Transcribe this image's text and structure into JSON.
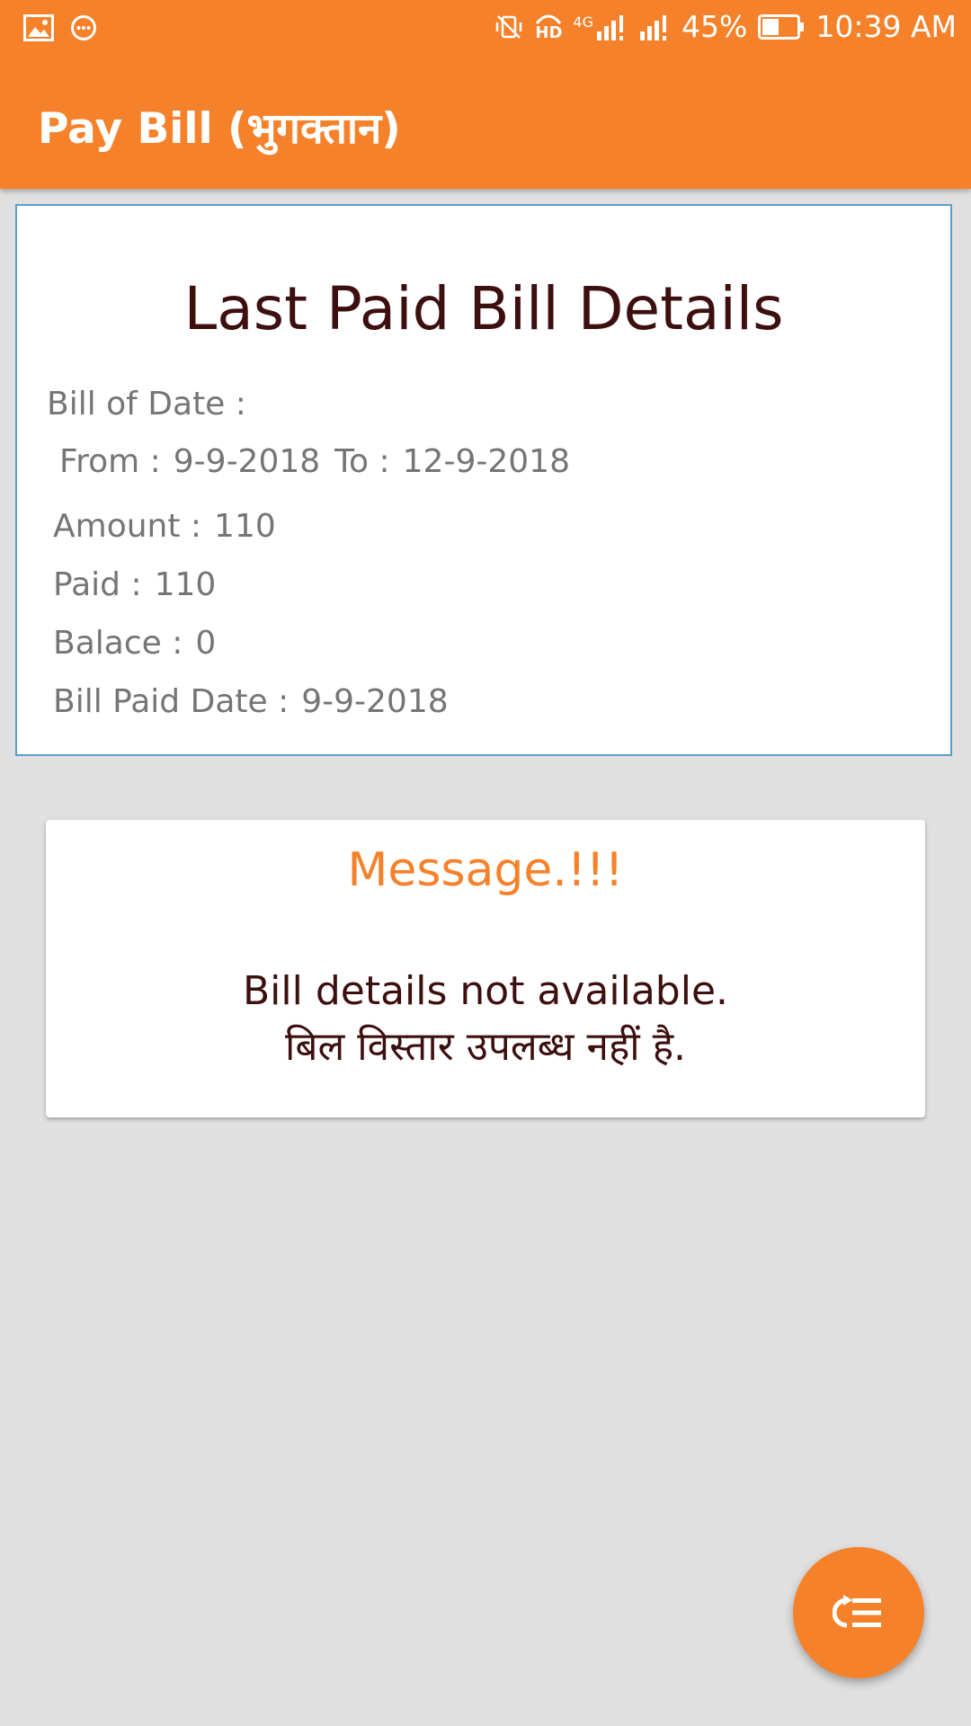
{
  "status_bar": {
    "battery_percent": "45%",
    "time": "10:39 AM",
    "network_label": "4G",
    "hd_label": "HD",
    "icons": [
      "gallery-icon",
      "chat-bubble-icon",
      "vibrate-off-icon",
      "hd-call-icon",
      "signal-icon",
      "battery-icon"
    ]
  },
  "app_bar": {
    "title": "Pay Bill (भुगक्तान)"
  },
  "bill_card": {
    "heading": "Last Paid Bill Details",
    "bill_of_date_label": "Bill of Date :",
    "from_label": "From :",
    "from_value": "9-9-2018",
    "to_label": "To :",
    "to_value": "12-9-2018",
    "amount_label": "Amount :",
    "amount_value": "110",
    "paid_label": "Paid :",
    "paid_value": "110",
    "balance_label": "Balace :",
    "balance_value": "0",
    "paid_date_label": "Bill Paid Date :",
    "paid_date_value": "9-9-2018"
  },
  "message_card": {
    "title": "Message.!!!",
    "line_english": "Bill details not available.",
    "line_hindi": "बिल विस्तार उपलब्ध नहीं है."
  },
  "fab": {
    "icon": "menu-return-icon"
  },
  "colors": {
    "accent": "#f5822b",
    "background": "#e0e0e0",
    "card_border": "#5b9ec9",
    "heading_text": "#3d0f0f",
    "label_text": "#757575"
  }
}
